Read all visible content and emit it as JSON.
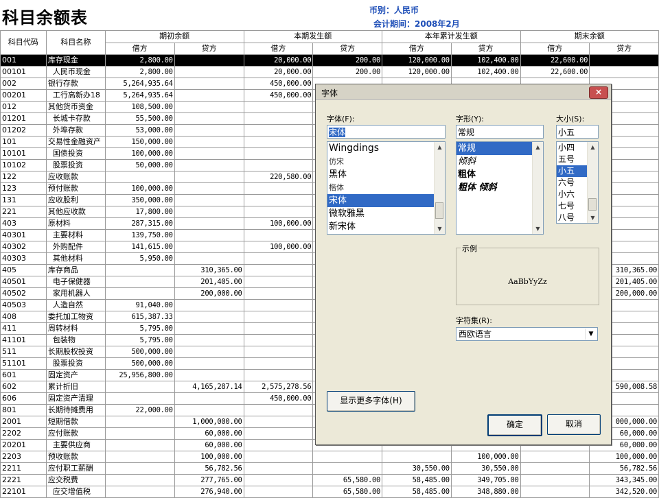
{
  "report": {
    "title": "科目余额表",
    "currency_text": "币别：人民币",
    "period_text": "会计期间：2008年2月"
  },
  "table": {
    "header": {
      "code": "科目代码",
      "name": "科目名称",
      "groups": [
        "期初余额",
        "本期发生额",
        "本年累计发生额",
        "期末余额"
      ],
      "debit": "借方",
      "credit": "贷方"
    },
    "rows": [
      {
        "code": "001",
        "name": "库存现金",
        "v": [
          "2,800.00",
          "",
          "20,000.00",
          "200.00",
          "120,000.00",
          "102,400.00",
          "22,600.00",
          ""
        ],
        "selected": true
      },
      {
        "code": "00101",
        "name": "  人民币现金",
        "v": [
          "2,800.00",
          "",
          "20,000.00",
          "200.00",
          "120,000.00",
          "102,400.00",
          "22,600.00",
          ""
        ]
      },
      {
        "code": "002",
        "name": "银行存款",
        "v": [
          "5,264,935.64",
          "",
          "450,000.00",
          "",
          "",
          "",
          "",
          ""
        ]
      },
      {
        "code": "00201",
        "name": "  工行高新办18",
        "v": [
          "5,264,935.64",
          "",
          "450,000.00",
          "",
          "",
          "",
          "",
          ""
        ]
      },
      {
        "code": "012",
        "name": "其他货币资金",
        "v": [
          "108,500.00",
          "",
          "",
          "",
          "",
          "",
          "",
          ""
        ]
      },
      {
        "code": "01201",
        "name": "  长城卡存款",
        "v": [
          "55,500.00",
          "",
          "",
          "",
          "",
          "",
          "",
          ""
        ]
      },
      {
        "code": "01202",
        "name": "  外埠存款",
        "v": [
          "53,000.00",
          "",
          "",
          "",
          "",
          "",
          "",
          ""
        ]
      },
      {
        "code": "101",
        "name": "交易性金融资产",
        "v": [
          "150,000.00",
          "",
          "",
          "",
          "",
          "",
          "",
          ""
        ]
      },
      {
        "code": "10101",
        "name": "  国债投资",
        "v": [
          "100,000.00",
          "",
          "",
          "",
          "",
          "",
          "",
          ""
        ]
      },
      {
        "code": "10102",
        "name": "  股票投资",
        "v": [
          "50,000.00",
          "",
          "",
          "",
          "",
          "",
          "",
          ""
        ]
      },
      {
        "code": "122",
        "name": "应收账款",
        "v": [
          "",
          "",
          "220,580.00",
          "",
          "",
          "",
          "",
          ""
        ]
      },
      {
        "code": "123",
        "name": "预付账款",
        "v": [
          "100,000.00",
          "",
          "",
          "",
          "",
          "",
          "",
          ""
        ]
      },
      {
        "code": "131",
        "name": "应收股利",
        "v": [
          "350,000.00",
          "",
          "",
          "",
          "",
          "",
          "",
          ""
        ]
      },
      {
        "code": "221",
        "name": "其他应收款",
        "v": [
          "17,800.00",
          "",
          "",
          "",
          "",
          "",
          "",
          ""
        ]
      },
      {
        "code": "403",
        "name": "原材料",
        "v": [
          "287,315.00",
          "",
          "100,000.00",
          "",
          "",
          "",
          "",
          ""
        ]
      },
      {
        "code": "40301",
        "name": "  主要材料",
        "v": [
          "139,750.00",
          "",
          "",
          "",
          "",
          "",
          "",
          ""
        ]
      },
      {
        "code": "40302",
        "name": "  外购配件",
        "v": [
          "141,615.00",
          "",
          "100,000.00",
          "",
          "",
          "",
          "",
          ""
        ]
      },
      {
        "code": "40303",
        "name": "  其他材料",
        "v": [
          "5,950.00",
          "",
          "",
          "",
          "",
          "",
          "",
          ""
        ]
      },
      {
        "code": "405",
        "name": "库存商品",
        "v": [
          "",
          "310,365.00",
          "",
          "",
          "",
          "",
          "",
          "310,365.00"
        ]
      },
      {
        "code": "40501",
        "name": "  电子保健器",
        "v": [
          "",
          "201,405.00",
          "",
          "",
          "",
          "",
          "",
          "201,405.00"
        ]
      },
      {
        "code": "40502",
        "name": "  家用机器人",
        "v": [
          "",
          "200,000.00",
          "",
          "",
          "",
          "",
          "",
          "200,000.00"
        ]
      },
      {
        "code": "40503",
        "name": "  人造自然",
        "v": [
          "91,040.00",
          "",
          "",
          "",
          "",
          "",
          "",
          ""
        ]
      },
      {
        "code": "408",
        "name": "委托加工物资",
        "v": [
          "615,387.33",
          "",
          "",
          "",
          "",
          "",
          "",
          ""
        ]
      },
      {
        "code": "411",
        "name": "周转材料",
        "v": [
          "5,795.00",
          "",
          "",
          "",
          "",
          "",
          "",
          ""
        ]
      },
      {
        "code": "41101",
        "name": "  包装物",
        "v": [
          "5,795.00",
          "",
          "",
          "",
          "",
          "",
          "",
          ""
        ]
      },
      {
        "code": "511",
        "name": "长期股权投资",
        "v": [
          "500,000.00",
          "",
          "",
          "",
          "",
          "",
          "",
          ""
        ]
      },
      {
        "code": "51101",
        "name": "  股票投资",
        "v": [
          "500,000.00",
          "",
          "",
          "",
          "",
          "",
          "",
          ""
        ]
      },
      {
        "code": "601",
        "name": "固定资产",
        "v": [
          "25,956,800.00",
          "",
          "",
          "",
          "",
          "",
          "",
          ""
        ]
      },
      {
        "code": "602",
        "name": "累计折旧",
        "v": [
          "",
          "4,165,287.14",
          "2,575,278.56",
          "",
          "",
          "",
          "",
          "590,008.58"
        ]
      },
      {
        "code": "606",
        "name": "固定资产清理",
        "v": [
          "",
          "",
          "450,000.00",
          "",
          "",
          "",
          "",
          ""
        ]
      },
      {
        "code": "801",
        "name": "长期待摊费用",
        "v": [
          "22,000.00",
          "",
          "",
          "",
          "",
          "",
          "",
          ""
        ]
      },
      {
        "code": "2001",
        "name": "短期借款",
        "v": [
          "",
          "1,000,000.00",
          "",
          "",
          "",
          "",
          "",
          "000,000.00"
        ]
      },
      {
        "code": "2202",
        "name": "应付账款",
        "v": [
          "",
          "60,000.00",
          "",
          "",
          "",
          "",
          "",
          "60,000.00"
        ]
      },
      {
        "code": "20201",
        "name": "  主要供应商",
        "v": [
          "",
          "60,000.00",
          "",
          "",
          "",
          "",
          "",
          "60,000.00"
        ]
      },
      {
        "code": "2203",
        "name": "预收账款",
        "v": [
          "",
          "100,000.00",
          "",
          "",
          "",
          "100,000.00",
          "",
          "100,000.00"
        ]
      },
      {
        "code": "2211",
        "name": "应付职工薪酬",
        "v": [
          "",
          "56,782.56",
          "",
          "",
          "30,550.00",
          "30,550.00",
          "",
          "56,782.56"
        ]
      },
      {
        "code": "2221",
        "name": "应交税费",
        "v": [
          "",
          "277,765.00",
          "",
          "65,580.00",
          "58,485.00",
          "349,705.00",
          "",
          "343,345.00"
        ]
      },
      {
        "code": "22101",
        "name": "  应交增值税",
        "v": [
          "",
          "276,940.00",
          "",
          "65,580.00",
          "58,485.00",
          "348,880.00",
          "",
          "342,520.00"
        ]
      }
    ]
  },
  "font_dialog": {
    "title": "字体",
    "close_symbol": "×",
    "font_label": "字体(F):",
    "font_value": "宋体",
    "fonts": [
      "Wingdings",
      "仿宋",
      "黑体",
      "楷体",
      "宋体",
      "微软雅黑",
      "新宋体"
    ],
    "selected_font": "宋体",
    "style_label": "字形(Y):",
    "style_value": "常规",
    "styles": [
      "常规",
      "倾斜",
      "粗体",
      "粗体 倾斜"
    ],
    "selected_style": "常规",
    "size_label": "大小(S):",
    "size_value": "小五",
    "sizes": [
      "小四",
      "五号",
      "小五",
      "六号",
      "小六",
      "七号",
      "八号"
    ],
    "selected_size": "小五",
    "sample_label": "示例",
    "sample_text": "AaBbYyZz",
    "charset_label": "字符集(R):",
    "charset_value": "西欧语言",
    "more_fonts_button": "显示更多字体(H)",
    "ok_button": "确定",
    "cancel_button": "取消"
  }
}
